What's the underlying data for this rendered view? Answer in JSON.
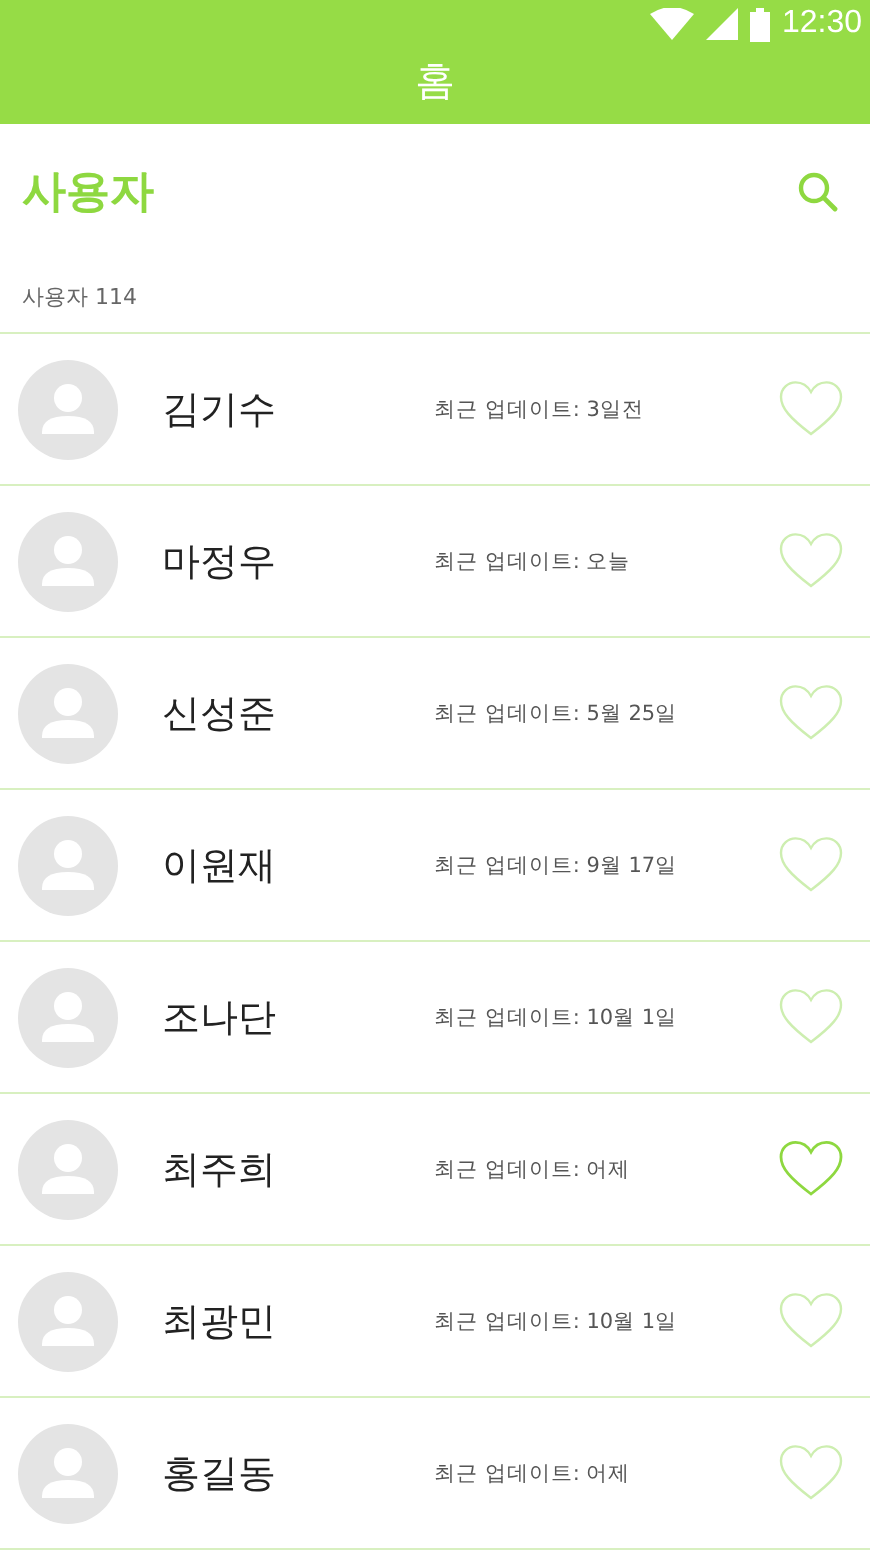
{
  "status_bar": {
    "time": "12:30"
  },
  "app_bar": {
    "title": "홈"
  },
  "header": {
    "title": "사용자"
  },
  "count_label": "사용자 114",
  "users": [
    {
      "name": "김기수",
      "update": "최근 업데이트: 3일전",
      "favorite": false
    },
    {
      "name": "마정우",
      "update": "최근 업데이트: 오늘",
      "favorite": false
    },
    {
      "name": "신성준",
      "update": "최근 업데이트: 5월 25일",
      "favorite": false
    },
    {
      "name": "이원재",
      "update": "최근 업데이트: 9월 17일",
      "favorite": false
    },
    {
      "name": "조나단",
      "update": "최근 업데이트: 10월 1일",
      "favorite": false
    },
    {
      "name": "최주희",
      "update": "최근 업데이트: 어제",
      "favorite": true
    },
    {
      "name": "최광민",
      "update": "최근 업데이트: 10월 1일",
      "favorite": false
    },
    {
      "name": "홍길동",
      "update": "최근 업데이트: 어제",
      "favorite": false
    }
  ]
}
